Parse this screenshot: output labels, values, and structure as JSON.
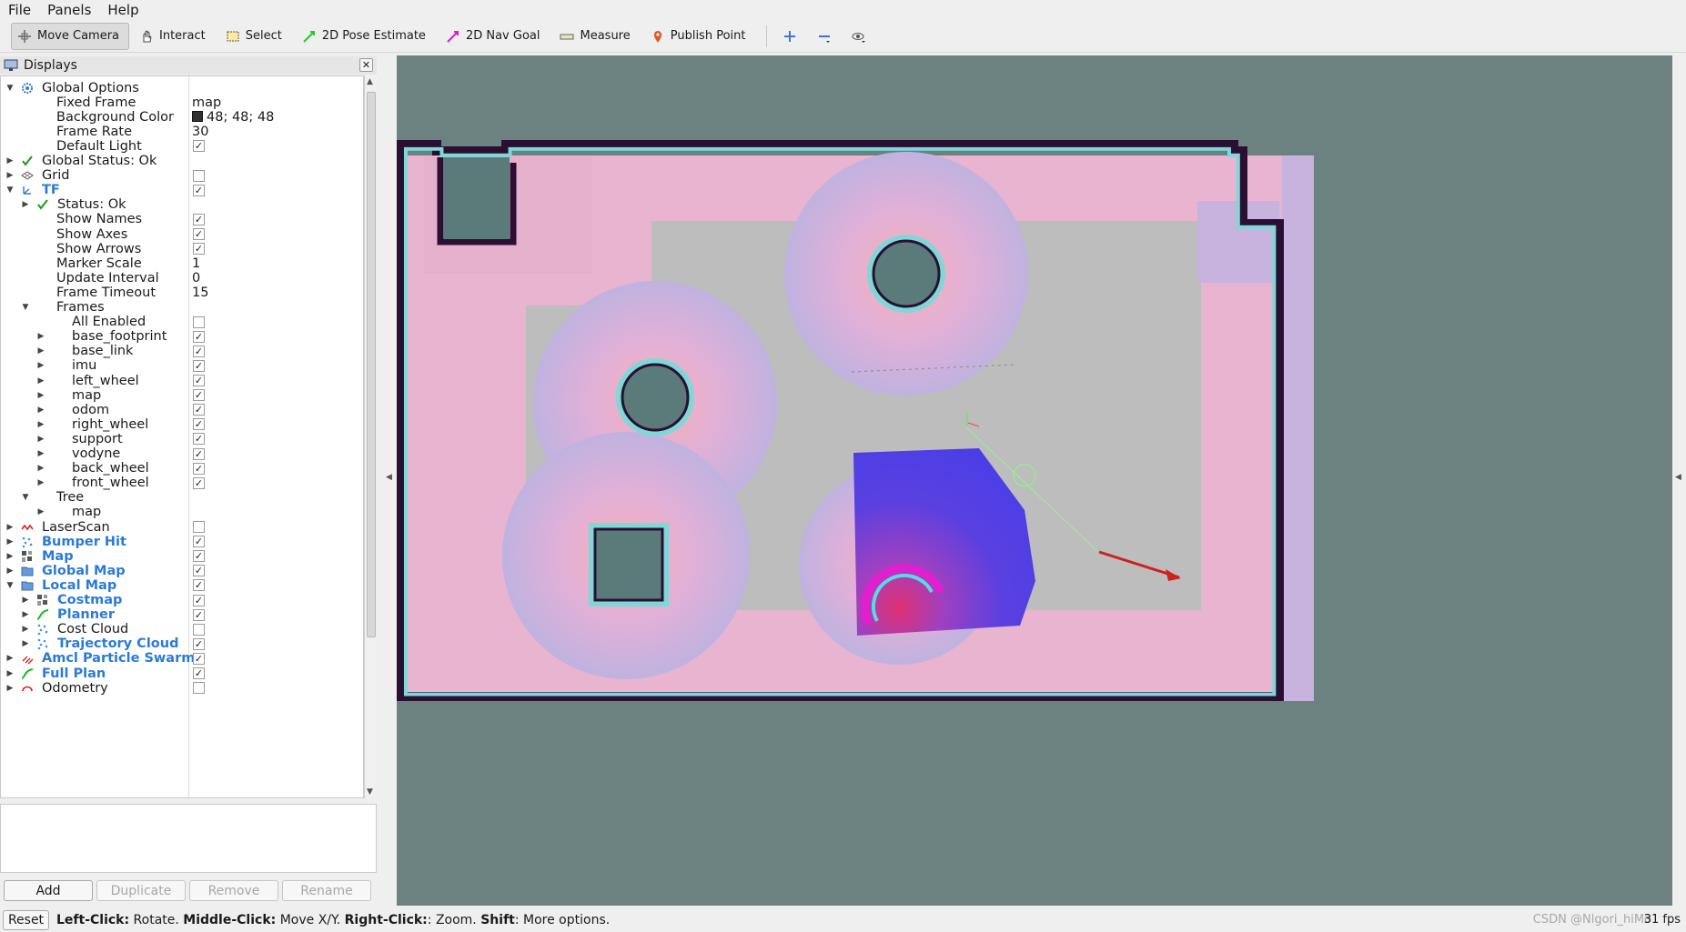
{
  "menu": [
    "File",
    "Panels",
    "Help"
  ],
  "toolbar": {
    "tools": [
      {
        "label": "Move Camera",
        "icon": "move-camera-icon",
        "active": true
      },
      {
        "label": "Interact",
        "icon": "hand-icon"
      },
      {
        "label": "Select",
        "icon": "select-box-icon"
      },
      {
        "label": "2D Pose Estimate",
        "icon": "green-arrow-icon"
      },
      {
        "label": "2D Nav Goal",
        "icon": "magenta-arrow-icon"
      },
      {
        "label": "Measure",
        "icon": "ruler-icon"
      },
      {
        "label": "Publish Point",
        "icon": "map-pin-icon"
      }
    ],
    "extras": [
      "plus-icon",
      "minus-icon",
      "eye-icon"
    ]
  },
  "displays": {
    "title": "Displays",
    "rows": [
      {
        "depth": 0,
        "arrow": "open",
        "icon": "gear",
        "label": "Global Options"
      },
      {
        "depth": 1,
        "label": "Fixed Frame",
        "value": "map"
      },
      {
        "depth": 1,
        "label": "Background Color",
        "value": "48; 48; 48",
        "swatch": "#303030"
      },
      {
        "depth": 1,
        "label": "Frame Rate",
        "value": "30"
      },
      {
        "depth": 1,
        "label": "Default Light",
        "check": true
      },
      {
        "depth": 0,
        "arrow": "closed",
        "icon": "ok",
        "label": "Global Status: Ok"
      },
      {
        "depth": 0,
        "arrow": "closed",
        "icon": "grid",
        "label": "Grid",
        "check": false
      },
      {
        "depth": 0,
        "arrow": "open",
        "icon": "tf",
        "label": "TF",
        "check": true,
        "blue": true
      },
      {
        "depth": 1,
        "arrow": "closed",
        "icon": "ok",
        "label": "Status: Ok"
      },
      {
        "depth": 1,
        "label": "Show Names",
        "check": true
      },
      {
        "depth": 1,
        "label": "Show Axes",
        "check": true
      },
      {
        "depth": 1,
        "label": "Show Arrows",
        "check": true
      },
      {
        "depth": 1,
        "label": "Marker Scale",
        "value": "1"
      },
      {
        "depth": 1,
        "label": "Update Interval",
        "value": "0"
      },
      {
        "depth": 1,
        "label": "Frame Timeout",
        "value": "15"
      },
      {
        "depth": 1,
        "arrow": "open",
        "label": "Frames"
      },
      {
        "depth": 2,
        "label": "All Enabled",
        "check": false
      },
      {
        "depth": 2,
        "arrow": "closed",
        "label": "base_footprint",
        "check": true
      },
      {
        "depth": 2,
        "arrow": "closed",
        "label": "base_link",
        "check": true
      },
      {
        "depth": 2,
        "arrow": "closed",
        "label": "imu",
        "check": true
      },
      {
        "depth": 2,
        "arrow": "closed",
        "label": "left_wheel",
        "check": true
      },
      {
        "depth": 2,
        "arrow": "closed",
        "label": "map",
        "check": true
      },
      {
        "depth": 2,
        "arrow": "closed",
        "label": "odom",
        "check": true
      },
      {
        "depth": 2,
        "arrow": "closed",
        "label": "right_wheel",
        "check": true
      },
      {
        "depth": 2,
        "arrow": "closed",
        "label": "support",
        "check": true
      },
      {
        "depth": 2,
        "arrow": "closed",
        "label": "vodyne",
        "check": true
      },
      {
        "depth": 2,
        "arrow": "closed",
        "label": "back_wheel",
        "check": true
      },
      {
        "depth": 2,
        "arrow": "closed",
        "label": "front_wheel",
        "check": true
      },
      {
        "depth": 1,
        "arrow": "open",
        "label": "Tree"
      },
      {
        "depth": 2,
        "arrow": "closed",
        "label": "map"
      },
      {
        "depth": 0,
        "arrow": "closed",
        "icon": "laser",
        "label": "LaserScan",
        "check": false
      },
      {
        "depth": 0,
        "arrow": "closed",
        "icon": "points",
        "label": "Bumper Hit",
        "check": true,
        "blue": true
      },
      {
        "depth": 0,
        "arrow": "closed",
        "icon": "map",
        "label": "Map",
        "check": true,
        "blue": true
      },
      {
        "depth": 0,
        "arrow": "closed",
        "icon": "folder",
        "label": "Global Map",
        "check": true,
        "blue": true
      },
      {
        "depth": 0,
        "arrow": "open",
        "icon": "folder",
        "label": "Local Map",
        "check": true,
        "blue": true
      },
      {
        "depth": 1,
        "arrow": "closed",
        "icon": "map",
        "label": "Costmap",
        "check": true,
        "blue": true
      },
      {
        "depth": 1,
        "arrow": "closed",
        "icon": "path",
        "label": "Planner",
        "check": true,
        "blue": true
      },
      {
        "depth": 1,
        "arrow": "closed",
        "icon": "points",
        "label": "Cost Cloud",
        "check": false
      },
      {
        "depth": 1,
        "arrow": "closed",
        "icon": "points",
        "label": "Trajectory Cloud",
        "check": true,
        "blue": true
      },
      {
        "depth": 0,
        "arrow": "closed",
        "icon": "swarm",
        "label": "Amcl Particle Swarm",
        "check": true,
        "blue": true
      },
      {
        "depth": 0,
        "arrow": "closed",
        "icon": "path",
        "label": "Full Plan",
        "check": true,
        "blue": true
      },
      {
        "depth": 0,
        "arrow": "closed",
        "icon": "odom",
        "label": "Odometry",
        "check": false
      }
    ]
  },
  "buttons": {
    "add": "Add",
    "duplicate": "Duplicate",
    "remove": "Remove",
    "rename": "Rename"
  },
  "status": {
    "reset": "Reset",
    "hint_parts": [
      {
        "bold": "Left-Click:",
        "text": " Rotate. "
      },
      {
        "bold": "Middle-Click:",
        "text": " Move X/Y. "
      },
      {
        "bold": "Right-Click:",
        "text": ": Zoom. "
      },
      {
        "bold": "Shift",
        "text": ": More options."
      }
    ],
    "fps": "31 fps",
    "watermark": "CSDN @Nlgori_hiMo"
  },
  "colors": {
    "viewport_bg": "#6b8280",
    "wall": "#2a0f33",
    "inflation_edge": "#7fd8d8",
    "free_space": "#bdbdbd",
    "costmap_blue": "#5040e0"
  }
}
